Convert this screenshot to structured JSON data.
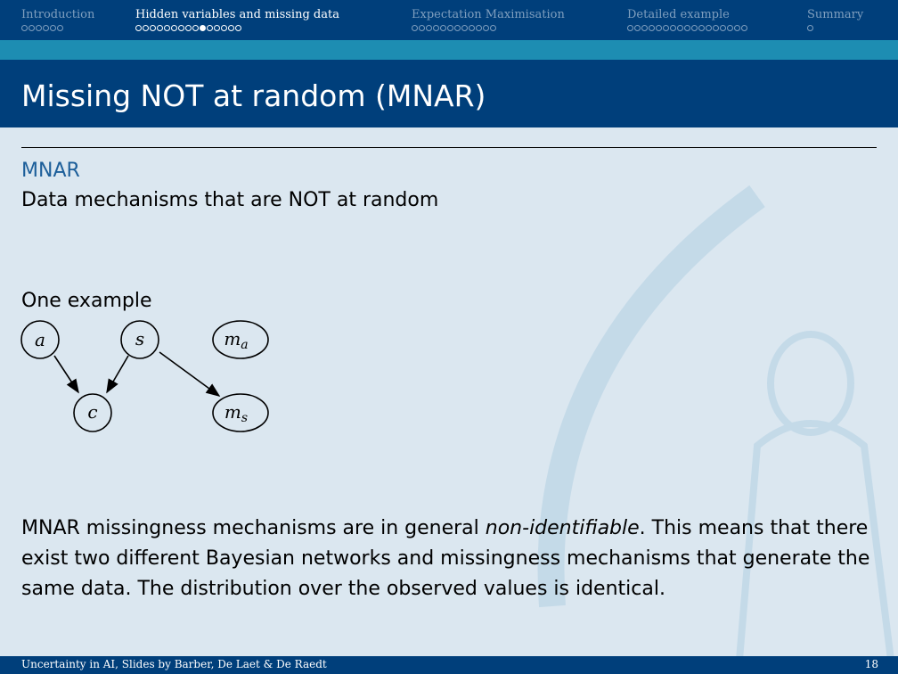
{
  "nav": {
    "sections": [
      {
        "label": "Introduction",
        "dots": 6,
        "current": -1,
        "active": false
      },
      {
        "label": "Hidden variables and missing data",
        "dots": 15,
        "current": 9,
        "active": true
      },
      {
        "label": "Expectation Maximisation",
        "dots": 12,
        "current": -1,
        "active": false
      },
      {
        "label": "Detailed example",
        "dots": 17,
        "current": -1,
        "active": false
      },
      {
        "label": "Summary",
        "dots": 1,
        "current": -1,
        "active": false
      }
    ]
  },
  "slide": {
    "title": "Missing NOT at random (MNAR)",
    "block_title": "MNAR",
    "subtitle": "Data mechanisms that are NOT at random",
    "example_label": "One example",
    "graph": {
      "nodes": {
        "a": "a",
        "s": "s",
        "ma": "m",
        "ma_sub": "a",
        "c": "c",
        "ms": "m",
        "ms_sub": "s"
      }
    },
    "para_1": "MNAR missingness mechanisms are in general ",
    "para_em": "non-identifiable",
    "para_2": ". This means that there exist two different Bayesian networks and missingness mechanisms that generate the same data. The distribution over the observed values is identical."
  },
  "footer": {
    "left": "Uncertainty in AI, Slides by Barber, De Laet & De Raedt",
    "page": "18"
  }
}
